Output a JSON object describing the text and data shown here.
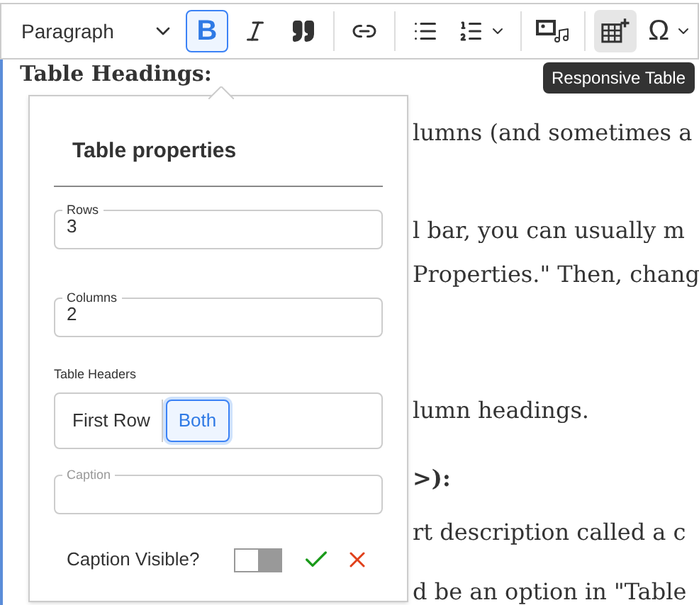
{
  "toolbar": {
    "block_format": "Paragraph",
    "buttons": [
      {
        "kind": "bold",
        "label": "B",
        "active": true,
        "hovered": false
      },
      {
        "kind": "italic",
        "active": false,
        "hovered": false
      },
      {
        "kind": "quote",
        "active": false,
        "hovered": false
      },
      {
        "kind": "divider"
      },
      {
        "kind": "link",
        "active": false,
        "hovered": false
      },
      {
        "kind": "divider"
      },
      {
        "kind": "bullets",
        "active": false,
        "hovered": false
      },
      {
        "kind": "numbered",
        "active": false,
        "hovered": false
      },
      {
        "kind": "divider"
      },
      {
        "kind": "media",
        "active": false,
        "hovered": false
      },
      {
        "kind": "divider"
      },
      {
        "kind": "table",
        "active": false,
        "hovered": true
      },
      {
        "kind": "symbol",
        "label": "Ω",
        "active": false,
        "hovered": false
      }
    ]
  },
  "tooltip": "Responsive Table",
  "document": {
    "heading": "Table Headings:",
    "lines": [
      {
        "text": "lumns (and sometimes a",
        "bold": false
      },
      {
        "text": "l bar, you can usually m",
        "bold": false
      },
      {
        "text": "Properties.\" Then, chang",
        "bold": false
      },
      {
        "text": "lumn headings.",
        "bold": false
      },
      {
        "text": ">):",
        "bold": true
      },
      {
        "text": "rt description called a c",
        "bold": false
      },
      {
        "text": "d be an option in \"Table",
        "bold": false
      }
    ]
  },
  "dialog": {
    "title": "Table properties",
    "fields": [
      {
        "label": "Rows",
        "value": "3"
      },
      {
        "label": "Columns",
        "value": "2"
      }
    ],
    "headers": {
      "label": "Table Headers",
      "options": [
        {
          "label": "First Row",
          "selected": false
        },
        {
          "label": "Both",
          "selected": true
        }
      ]
    },
    "caption": {
      "placeholder": "Caption"
    },
    "caption_visible": {
      "label": "Caption Visible?",
      "on": false
    }
  }
}
